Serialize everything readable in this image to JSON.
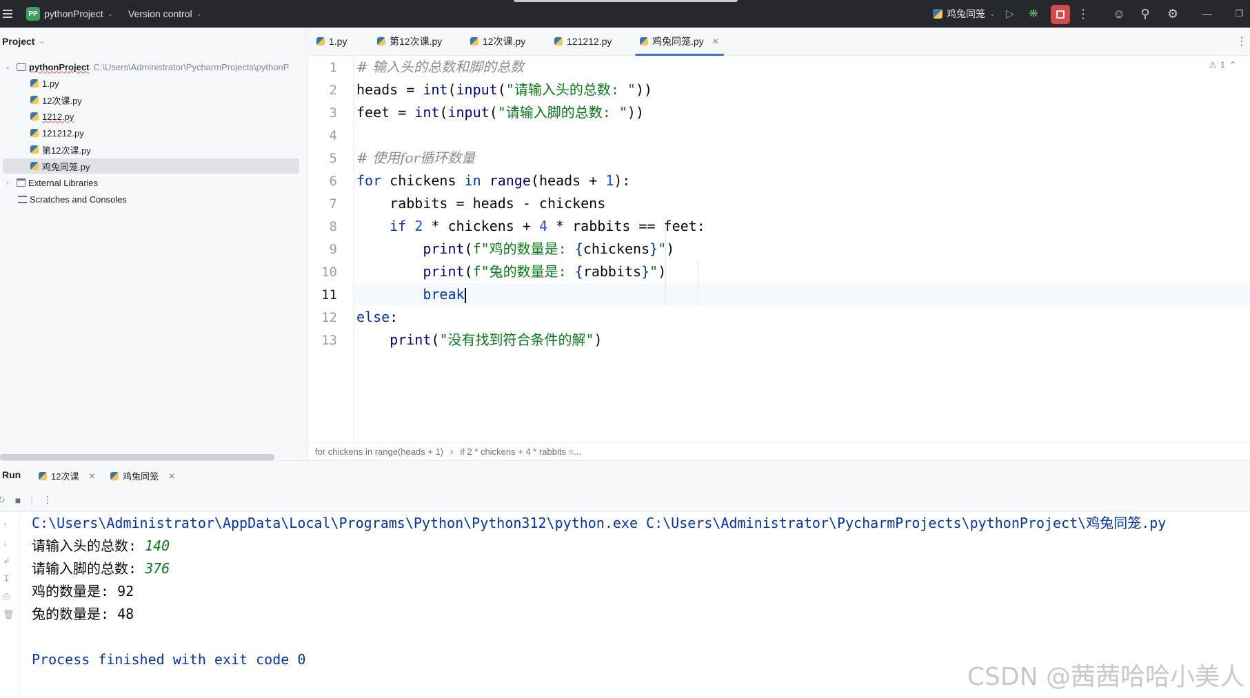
{
  "titlebar": {
    "badge": "PP",
    "project": "pythonProject",
    "vcs": "Version control",
    "run_config": "鸡兔同笼"
  },
  "project_panel": {
    "title": "Project",
    "root_name": "pythonProject",
    "root_path": "C:\\Users\\Administrator\\PycharmProjects\\pythonP",
    "files": [
      "1.py",
      "12次课.py",
      "1212.py",
      "121212.py",
      "第12次课.py",
      "鸡兔同笼.py"
    ],
    "external": "External Libraries",
    "scratches": "Scratches and Consoles"
  },
  "editor": {
    "tabs": [
      "1.py",
      "第12次课.py",
      "12次课.py",
      "121212.py",
      "鸡兔同笼.py"
    ],
    "warning_count": "1",
    "line_numbers": [
      "1",
      "2",
      "3",
      "4",
      "5",
      "6",
      "7",
      "8",
      "9",
      "10",
      "11",
      "12",
      "13"
    ],
    "lines": {
      "l1_comment": "# 输入头的总数和脚的总数",
      "l2_var": "heads",
      "l2_eq": " = ",
      "l2_int": "int",
      "l2_open": "(",
      "l2_input": "input",
      "l2_open2": "(",
      "l2_str": "\"请输入头的总数: \"",
      "l2_close": "))",
      "l3_var": "feet",
      "l3_eq": " = ",
      "l3_int": "int",
      "l3_open": "(",
      "l3_input": "input",
      "l3_open2": "(",
      "l3_str": "\"请输入脚的总数: \"",
      "l3_close": "))",
      "l5_comment": "# 使用for循环数量",
      "l6_for": "for",
      "l6_a": " chickens ",
      "l6_in": "in",
      "l6_b": " ",
      "l6_range": "range",
      "l6_c": "(heads + ",
      "l6_num": "1",
      "l6_d": "):",
      "l7": "rabbits = heads - chickens",
      "l8_if": "if",
      "l8_a": " ",
      "l8_n1": "2",
      "l8_b": " * chickens + ",
      "l8_n2": "4",
      "l8_c": " * rabbits == feet:",
      "l9_print": "print",
      "l9_a": "(",
      "l9_str": "f\"鸡的数量是: ",
      "l9_br1": "{",
      "l9_var": "chickens",
      "l9_br2": "}",
      "l9_end": "\"",
      "l9_close": ")",
      "l10_print": "print",
      "l10_a": "(",
      "l10_str": "f\"兔的数量是: ",
      "l10_br1": "{",
      "l10_var": "rabbits",
      "l10_br2": "}",
      "l10_end": "\"",
      "l10_close": ")",
      "l11_break": "break",
      "l12_else": "else",
      "l12_colon": ":",
      "l13_print": "print",
      "l13_a": "(",
      "l13_str": "\"没有找到符合条件的解\"",
      "l13_close": ")"
    },
    "breadcrumb": [
      "for chickens in range(heads + 1)",
      "if 2 * chickens + 4 * rabbits =..."
    ]
  },
  "run": {
    "title": "Run",
    "tabs": [
      "12次课",
      "鸡兔同笼"
    ],
    "output": {
      "cmd": "C:\\Users\\Administrator\\AppData\\Local\\Programs\\Python\\Python312\\python.exe C:\\Users\\Administrator\\PycharmProjects\\pythonProject\\鸡兔同笼.py",
      "prompt1": "请输入头的总数: ",
      "input1": "140",
      "prompt2": "请输入脚的总数: ",
      "input2": "376",
      "result1": "鸡的数量是: 92",
      "result2": "兔的数量是: 48",
      "finish": "Process finished with exit code 0"
    }
  },
  "watermark": "CSDN @茜茜哈哈小美人",
  "icons": [
    "menu-icon",
    "run-icon",
    "debug-icon",
    "stop-icon",
    "more-icon",
    "add-user-icon",
    "search-icon",
    "settings-icon",
    "minimize-icon",
    "restore-icon",
    "python-file-icon",
    "folder-icon",
    "warning-icon"
  ]
}
